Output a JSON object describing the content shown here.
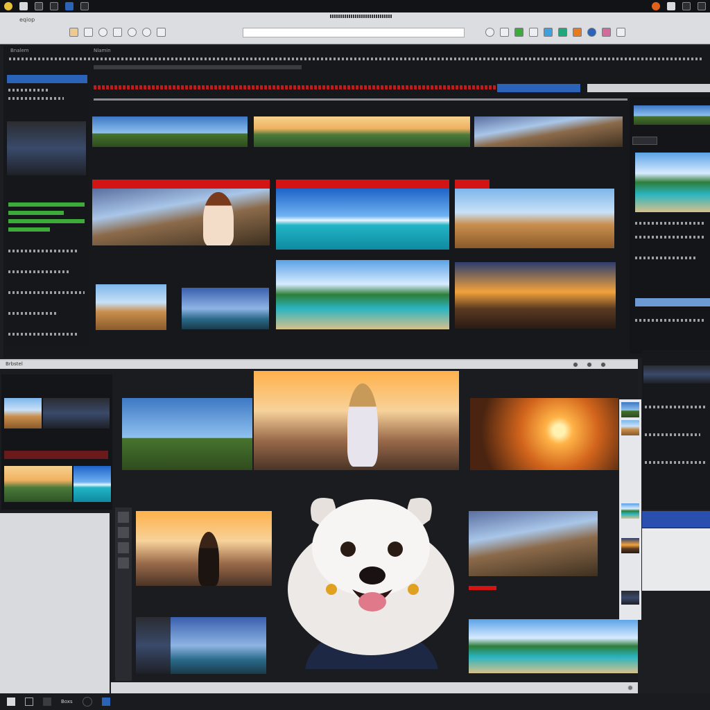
{
  "window": {
    "menu_title": "eqiop",
    "title_bar": ""
  },
  "top_panel": {
    "tab_label": "Bnalem",
    "header_label": "Nlamin"
  },
  "bottom_panel": {
    "label": "Brbstel"
  },
  "taskbar": {
    "item_label": "Boxs"
  },
  "colors": {
    "accent": "#d21414",
    "progress_green": "#3cab3a",
    "selection_blue": "#2a63b8",
    "background": "#1d1e21"
  },
  "icons": [
    "app-logo-icon",
    "folder-icon",
    "grid-icon",
    "pen-icon",
    "monitor-icon",
    "settings-icon",
    "close-icon",
    "maximize-icon",
    "minimize-icon",
    "search-icon",
    "windows-start-icon"
  ]
}
